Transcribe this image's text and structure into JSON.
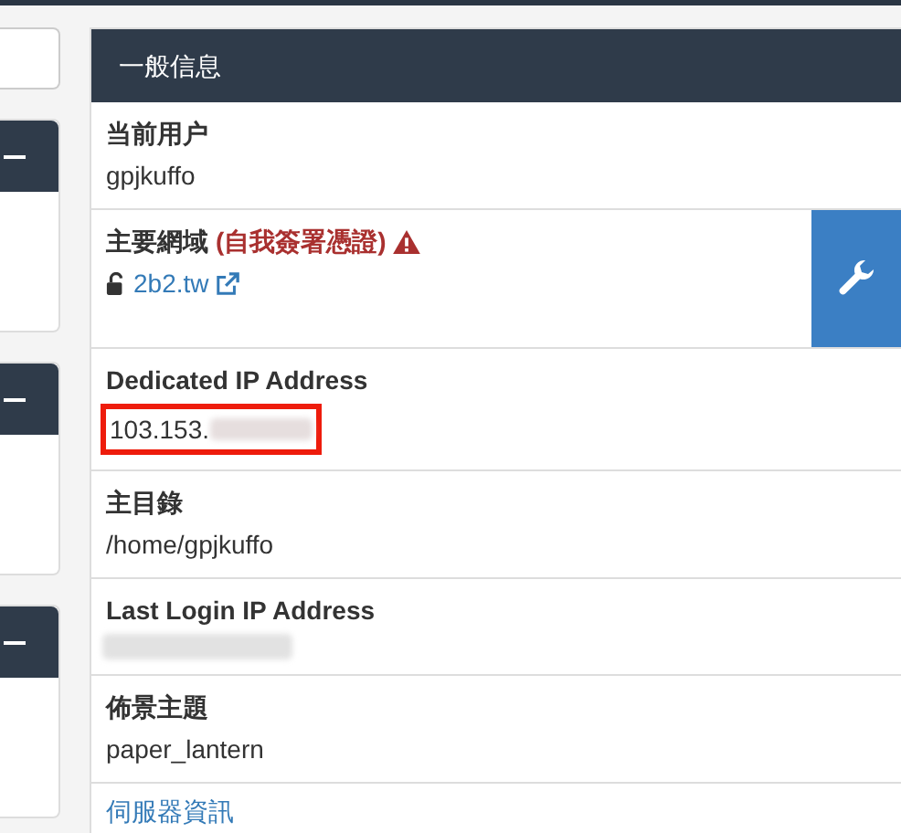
{
  "sidebar": {
    "panels": [
      {
        "kind": "collapsible"
      },
      {
        "kind": "collapsible"
      },
      {
        "kind": "collapsible"
      }
    ]
  },
  "panel": {
    "title": "一般信息",
    "rows": [
      {
        "kind": "text",
        "label": "当前用户",
        "value": "gpjkuffo"
      },
      {
        "kind": "domain",
        "label": "主要網域",
        "warning": "(自我簽署憑證)",
        "value": "2b2.tw"
      },
      {
        "kind": "ip",
        "label": "Dedicated IP Address",
        "value": "103.153.",
        "highlighted": true
      },
      {
        "kind": "text",
        "label": "主目錄",
        "value": "/home/gpjkuffo"
      },
      {
        "kind": "redacted",
        "label": "Last Login IP Address"
      },
      {
        "kind": "text",
        "label": "佈景主題",
        "value": "paper_lantern"
      }
    ],
    "link": "伺服器資訊"
  }
}
